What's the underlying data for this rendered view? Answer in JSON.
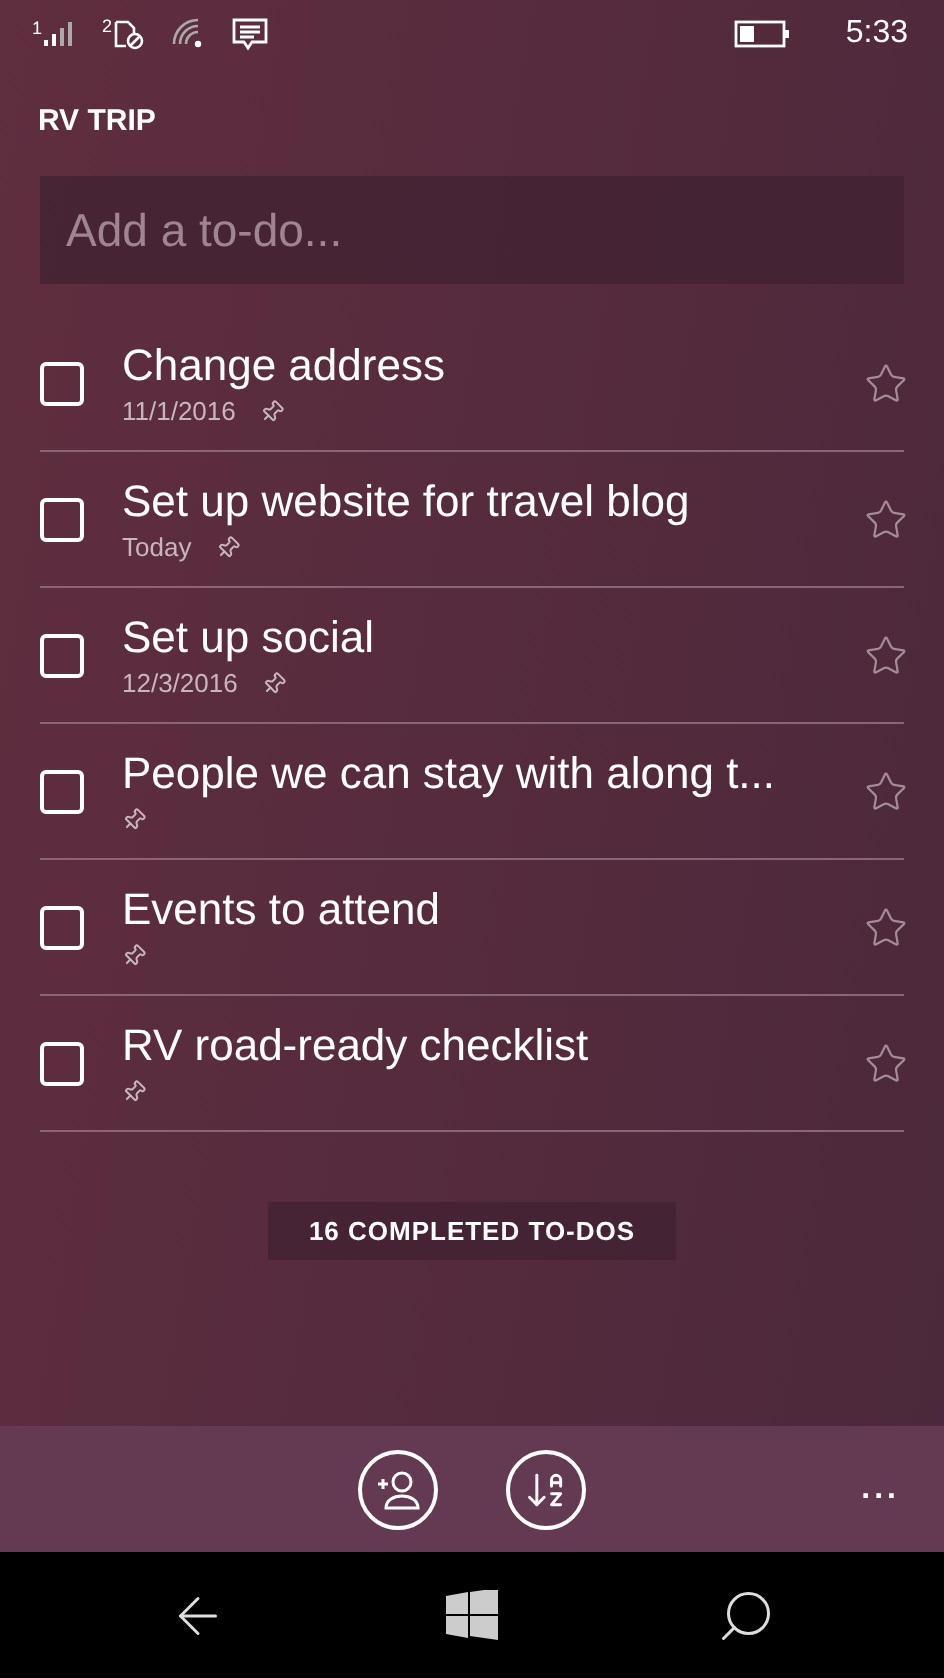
{
  "status_bar": {
    "sim_1": "1",
    "sim_2": "2",
    "time": "5:33"
  },
  "list_title": "RV TRIP",
  "add_field": {
    "placeholder": "Add a to-do..."
  },
  "todos": [
    {
      "title": "Change address",
      "due": "11/1/2016",
      "checked": false,
      "starred": false
    },
    {
      "title": "Set up website for travel blog",
      "due": "Today",
      "checked": false,
      "starred": false
    },
    {
      "title": "Set up social",
      "due": "12/3/2016",
      "checked": false,
      "starred": false
    },
    {
      "title": "People we can stay with along t...",
      "checked": false,
      "starred": false
    },
    {
      "title": "Events to attend",
      "checked": false,
      "starred": false
    },
    {
      "title": "RV road-ready checklist",
      "checked": false,
      "starred": false
    }
  ],
  "completed_button": "16 COMPLETED TO-DOS",
  "app_bar": {
    "more": "..."
  }
}
